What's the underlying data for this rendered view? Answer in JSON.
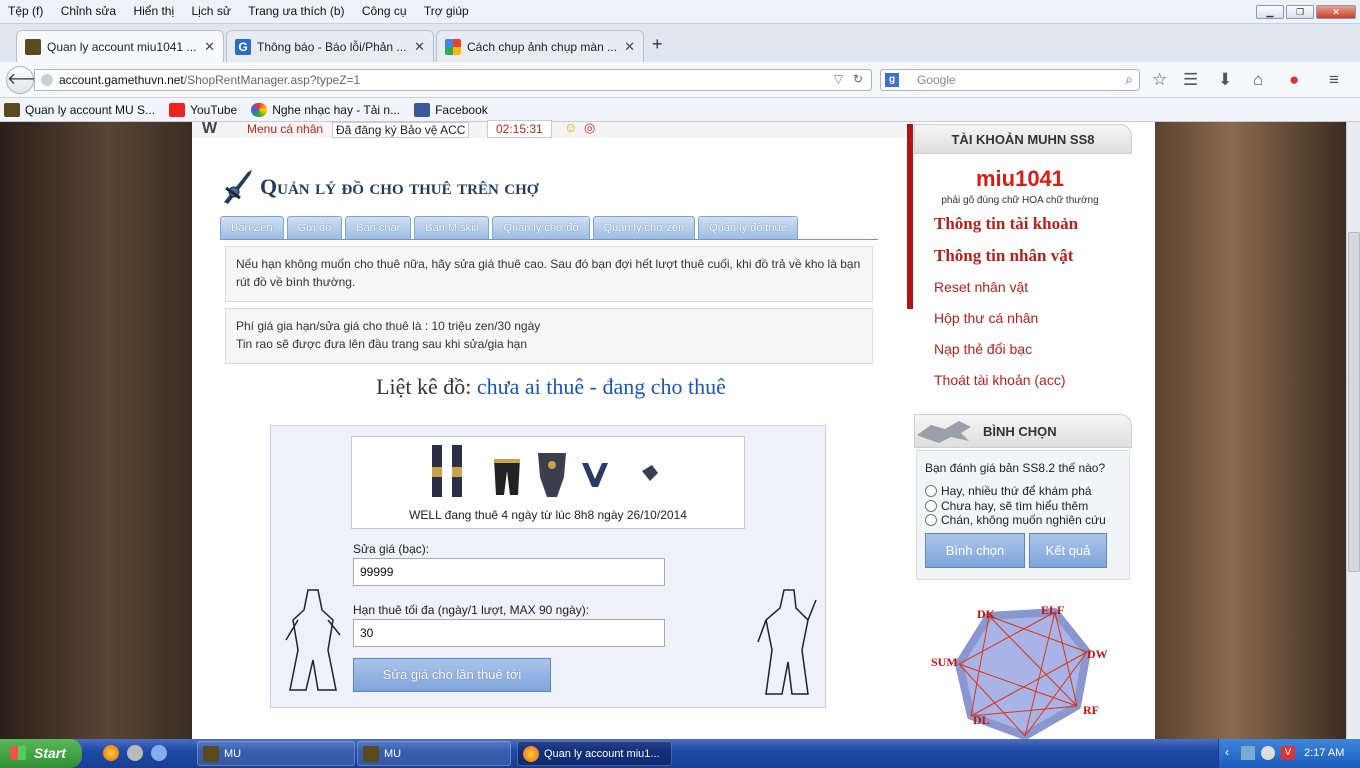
{
  "menubar": {
    "items": [
      "Tệp (f)",
      "Chỉnh sửa",
      "Hiển thị",
      "Lịch sử",
      "Trang ưa thích (b)",
      "Công cụ",
      "Trợ giúp"
    ]
  },
  "tabs": [
    {
      "title": "Quan ly account miu1041 ...",
      "icon": "mu-game-icon"
    },
    {
      "title": "Thông báo - Báo lỗi/Phản ...",
      "icon": "g-site-icon"
    },
    {
      "title": "Cách chụp ảnh chụp màn ...",
      "icon": "google-icon"
    }
  ],
  "nav": {
    "url_host": "account.gamethuvn.net",
    "url_path": "/ShopRentManager.asp?typeZ=1",
    "search_placeholder": "Google"
  },
  "bookmarks": [
    {
      "label": "Quan ly account MU S...",
      "icon": "mu-game-icon"
    },
    {
      "label": "YouTube",
      "icon": "youtube-icon"
    },
    {
      "label": "Nghe nhạc hay - Tải n...",
      "icon": "music-icon"
    },
    {
      "label": "Facebook",
      "icon": "facebook-icon"
    }
  ],
  "topstrip": {
    "menu_label": "Menu cá nhân",
    "protect_label": "Đã đăng ký Bảo vệ ACC",
    "timer": "02:15:31"
  },
  "page": {
    "title": "Quản lý đồ cho thuê trên chợ",
    "tabs": [
      "Bán Zen",
      "Gửi đồ",
      "Bán char",
      "Bán M.skill",
      "Quản lý chợ đồ",
      "Quản lý chợ zen",
      "Quản lý đồ thuê"
    ],
    "info1": "Nếu hạn không muốn cho thuê nữa, hãy sửa giá thuê cao. Sau đó bạn đợi hết lượt thuê cuối, khi đồ trả về kho là bạn rút đồ về bình thường.",
    "info2_line1": "Phí giá gia hạn/sửa giá cho thuê là : 10 triệu zen/30 ngày",
    "info2_line2": "Tin rao sẽ được đưa lên đầu trang sau khi sửa/gia hạn",
    "list_prefix": "Liệt kê đồ:",
    "list_link1": "chưa ai thuê",
    "list_sep": "-",
    "list_link2": "đang cho thuê",
    "item_desc": "WELL đang thuê 4 ngày từ lúc 8h8 ngày 26/10/2014",
    "price_label": "Sửa giá (bạc):",
    "price_value": "99999",
    "days_label": "Hạn thuê tối đa (ngày/1 lượt, MAX 90 ngày):",
    "days_value": "30",
    "submit_label": "Sửa giá cho lần thuê tới"
  },
  "sidebar": {
    "header": "TÀI KHOẢN MUHN SS8",
    "username": "miu1041",
    "note": "phải gõ đúng chữ HOA chữ thường",
    "links": [
      "Thông tin tài khoản",
      "Thông tin nhân vật",
      "Reset nhân vật",
      "Hộp thư cá nhân",
      "Nạp thẻ đổi bạc",
      "Thoát tài khoản (acc)"
    ],
    "vote_header": "BÌNH CHỌN",
    "vote_question": "Bạn đánh giá bản SS8.2 thế nào?",
    "vote_options": [
      "Hay, nhiều thứ để khám phá",
      "Chưa hay, sẽ tìm hiểu thêm",
      "Chán, không muốn nghiên cứu"
    ],
    "vote_button": "Bình chọn",
    "result_button": "Kết quả",
    "diagram_labels": [
      "DK",
      "ELF",
      "DW",
      "RF",
      "DL",
      "SUM"
    ]
  },
  "taskbar": {
    "start": "Start",
    "tasks": [
      "MU",
      "MU",
      "Quan ly account miu1..."
    ],
    "clock": "2:17 AM"
  },
  "colors": {
    "link_red": "#b8201a",
    "accent_blue": "#1a56b8",
    "username_red": "#d91c14"
  }
}
